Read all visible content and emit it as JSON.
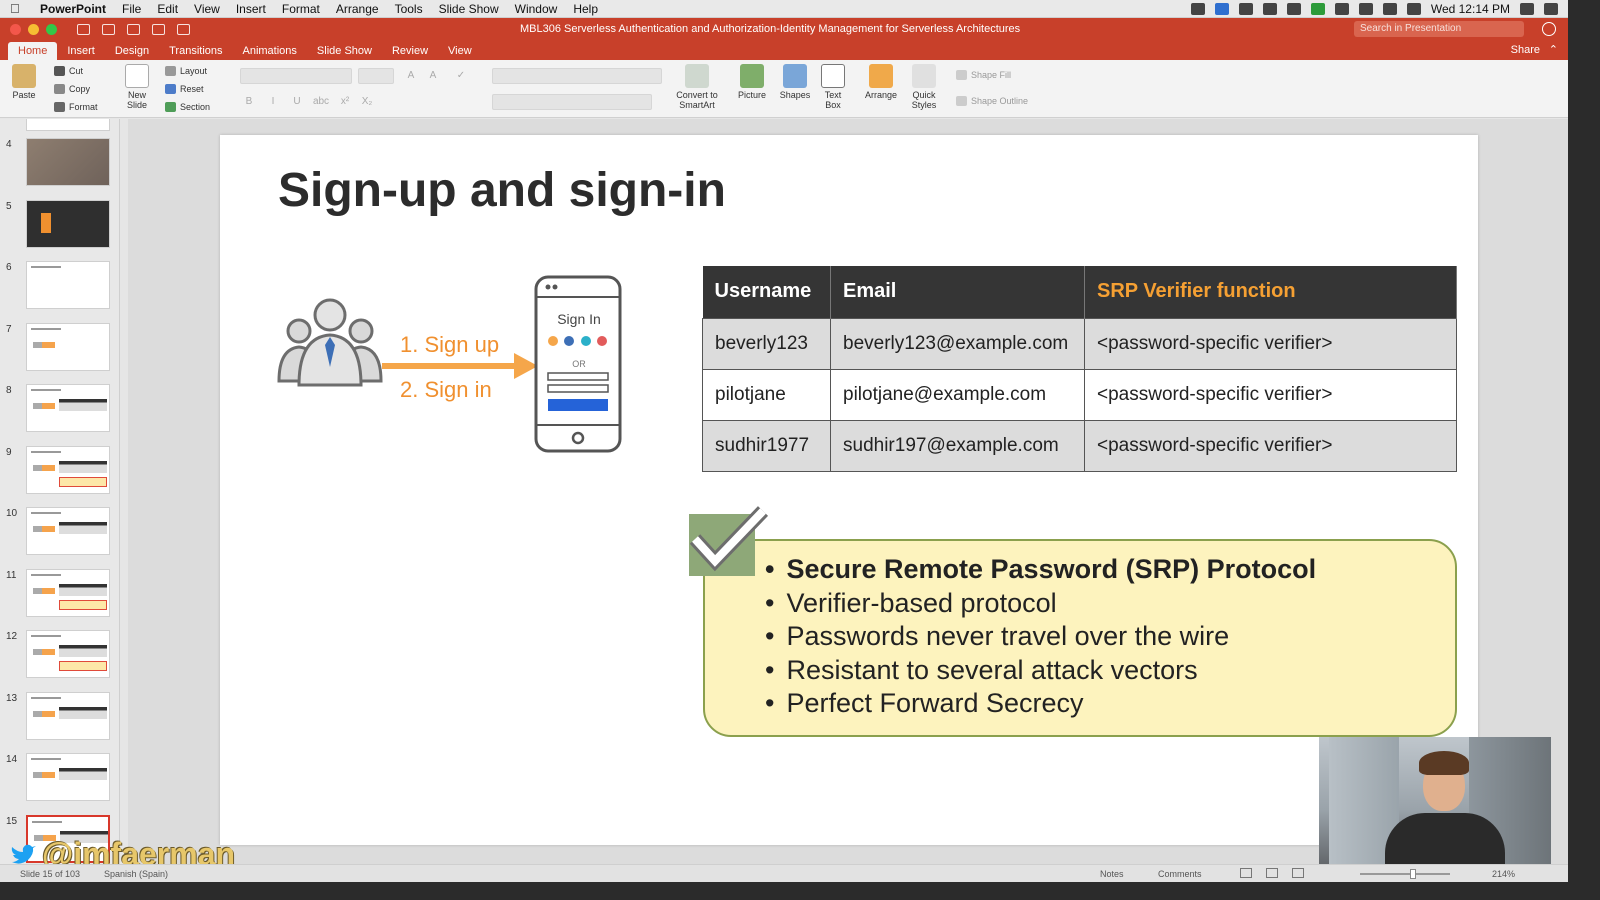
{
  "menubar": {
    "app": "PowerPoint",
    "items": [
      "File",
      "Edit",
      "View",
      "Insert",
      "Format",
      "Arrange",
      "Tools",
      "Slide Show",
      "Window",
      "Help"
    ],
    "clock": "Wed 12:14 PM"
  },
  "window": {
    "title": "MBL306 Serverless Authentication and Authorization-Identity Management for Serverless Architectures",
    "search_placeholder": "Search in Presentation"
  },
  "ribbon": {
    "tabs": [
      "Home",
      "Insert",
      "Design",
      "Transitions",
      "Animations",
      "Slide Show",
      "Review",
      "View"
    ],
    "share": "Share",
    "paste": "Paste",
    "cut": "Cut",
    "copy": "Copy",
    "format": "Format",
    "new_slide": "New Slide",
    "layout": "Layout",
    "reset": "Reset",
    "section": "Section",
    "convert_smartart": "Convert to SmartArt",
    "picture": "Picture",
    "shapes": "Shapes",
    "text_box": "Text Box",
    "arrange": "Arrange",
    "quick_styles": "Quick Styles",
    "shape_fill": "Shape Fill",
    "shape_outline": "Shape Outline",
    "format_buttons": [
      "B",
      "I",
      "U",
      "abc",
      "x²",
      "X₂"
    ]
  },
  "thumbnails": [
    "4",
    "5",
    "6",
    "7",
    "8",
    "9",
    "10",
    "11",
    "12",
    "13",
    "14",
    "15"
  ],
  "slide": {
    "title": "Sign-up and sign-in",
    "signup": "1. Sign up",
    "signin": "2. Sign in",
    "phone_label": "Sign In",
    "phone_or": "OR",
    "table": {
      "headers": [
        "Username",
        "Email",
        "SRP Verifier function"
      ],
      "rows": [
        [
          "beverly123",
          "beverly123@example.com",
          "<password-specific verifier>"
        ],
        [
          "pilotjane",
          "pilotjane@example.com",
          "<password-specific verifier>"
        ],
        [
          "sudhir1977",
          "sudhir197@example.com",
          "<password-specific verifier>"
        ]
      ]
    },
    "bullets": [
      "Secure Remote Password (SRP) Protocol",
      "Verifier-based protocol",
      "Passwords never travel over the wire",
      "Resistant to several attack vectors",
      "Perfect Forward Secrecy"
    ]
  },
  "overlay": {
    "handle": "@jmfaerman"
  },
  "status": {
    "slide_count": "Slide 15 of 103",
    "language": "Spanish (Spain)",
    "notes": "Notes",
    "comments": "Comments",
    "zoom": "214%"
  },
  "colors": {
    "accent": "#c8402a",
    "orange": "#f0902f",
    "callout": "#fdf3be"
  }
}
